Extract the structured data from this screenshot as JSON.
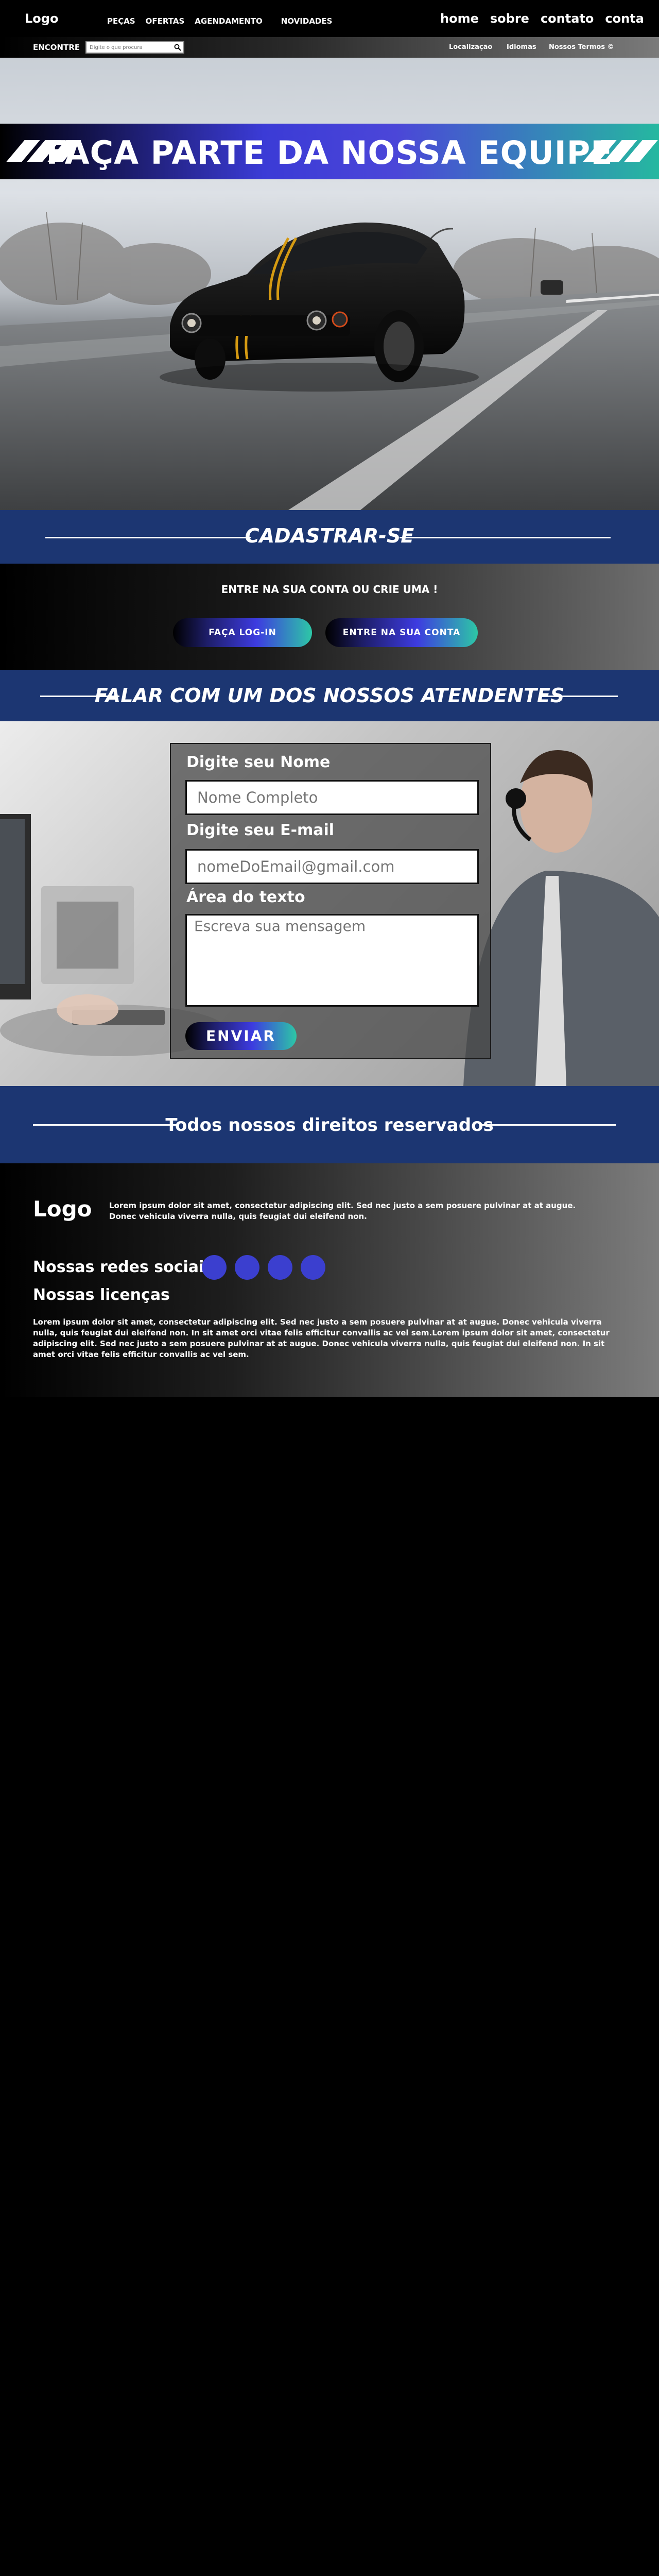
{
  "nav": {
    "logo": "Logo",
    "left_links": [
      "PEÇAS",
      "OFERTAS",
      "AGENDAMENTO",
      "NOVIDADES"
    ],
    "right_links": [
      "home",
      "sobre",
      "contato",
      "conta"
    ]
  },
  "subnav": {
    "find_label": "ENCONTRE",
    "search_placeholder": "Digite o que procura",
    "links": [
      "Localização",
      "Idiomas",
      "Nossos Termos ©"
    ]
  },
  "hero": {
    "banner_title": "FAÇA PARTE DA NOSSA EQUIPE"
  },
  "signup": {
    "heading": "CADASTRAR-SE",
    "question": "ENTRE NA SUA CONTA OU CRIE UMA !",
    "login_button": "FAÇA LOG-IN",
    "enter_button": "ENTRE NA SUA CONTA"
  },
  "contact": {
    "heading": "FALAR COM UM DOS NOSSOS ATENDENTES",
    "name_label": "Digite seu Nome",
    "name_placeholder": "Nome Completo",
    "email_label": "Digite seu E-mail",
    "email_placeholder": "nomeDoEmail@gmail.com",
    "message_label": "Área do texto",
    "message_placeholder": "Escreva sua mensagem",
    "send_button": "ENVIAR"
  },
  "rights": {
    "text": "Todos nossos direitos reservados"
  },
  "footer": {
    "logo": "Logo",
    "intro": "Lorem ipsum dolor sit amet, consectetur adipiscing elit. Sed nec justo a sem posuere pulvinar at at augue. Donec vehicula viverra nulla, quis feugiat dui eleifend non.",
    "social_heading": "Nossas redes sociais",
    "licenses_heading": "Nossas licenças",
    "licenses_text": "Lorem ipsum dolor sit amet, consectetur adipiscing elit. Sed nec justo a sem posuere pulvinar at at augue. Donec vehicula viverra nulla, quis feugiat dui eleifend non. In sit amet orci vitae felis efficitur convallis ac vel sem.Lorem ipsum dolor sit amet, consectetur adipiscing elit. Sed nec justo a sem posuere pulvinar at at augue. Donec vehicula viverra nulla, quis feugiat dui eleifend non. In sit amet orci vitae felis efficitur convallis ac vel sem."
  },
  "colors": {
    "band_blue": "#1c3672",
    "accent_purple": "#3d3be0",
    "accent_teal": "#2dc7a6",
    "social_circle": "#3b3fcf"
  },
  "icons": {
    "search": "search-icon",
    "social": [
      "social-icon",
      "social-icon",
      "social-icon",
      "social-icon"
    ]
  }
}
